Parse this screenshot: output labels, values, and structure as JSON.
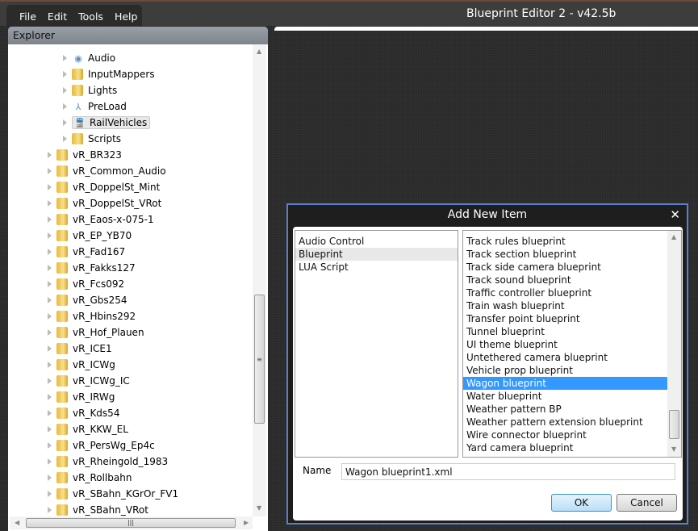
{
  "app": {
    "title": "Blueprint Editor 2 - v42.5b",
    "menu": [
      "File",
      "Edit",
      "Tools",
      "Help"
    ]
  },
  "explorer": {
    "title": "Explorer",
    "children": [
      {
        "label": "Audio",
        "icon": "audio-icon"
      },
      {
        "label": "InputMappers",
        "icon": "folder-icon"
      },
      {
        "label": "Lights",
        "icon": "folder-icon"
      },
      {
        "label": "PreLoad",
        "icon": "preload-icon"
      },
      {
        "label": "RailVehicles",
        "icon": "train-icon",
        "selected": true
      },
      {
        "label": "Scripts",
        "icon": "folder-icon"
      }
    ],
    "folders": [
      "vR_BR323",
      "vR_Common_Audio",
      "vR_DoppelSt_Mint",
      "vR_DoppelSt_VRot",
      "vR_Eaos-x-075-1",
      "vR_EP_YB70",
      "vR_Fad167",
      "vR_Fakks127",
      "vR_Fcs092",
      "vR_Gbs254",
      "vR_Hbins292",
      "vR_Hof_Plauen",
      "vR_ICE1",
      "vR_ICWg",
      "vR_ICWg_IC",
      "vR_IRWg",
      "vR_Kds54",
      "vR_KKW_EL",
      "vR_PersWg_Ep4c",
      "vR_Rheingold_1983",
      "vR_Rollbahn",
      "vR_SBahn_KGrOr_FV1",
      "vR_SBahn_VRot"
    ]
  },
  "dialog": {
    "title": "Add New Item",
    "close": "✕",
    "categories": [
      "Audio Control",
      "Blueprint",
      "LUA Script"
    ],
    "selected_category": 1,
    "items": [
      "Track rules blueprint",
      "Track section blueprint",
      "Track side camera blueprint",
      "Track sound blueprint",
      "Traffic controller blueprint",
      "Train wash blueprint",
      "Transfer point blueprint",
      "Tunnel blueprint",
      "UI theme blueprint",
      "Untethered camera blueprint",
      "Vehicle prop blueprint",
      "Wagon blueprint",
      "Water blueprint",
      "Weather pattern BP",
      "Weather pattern extension blueprint",
      "Wire connector blueprint",
      "Yard camera blueprint"
    ],
    "selected_item": 11,
    "name_label": "Name",
    "name_value": "Wagon blueprint1.xml",
    "ok": "OK",
    "cancel": "Cancel"
  }
}
